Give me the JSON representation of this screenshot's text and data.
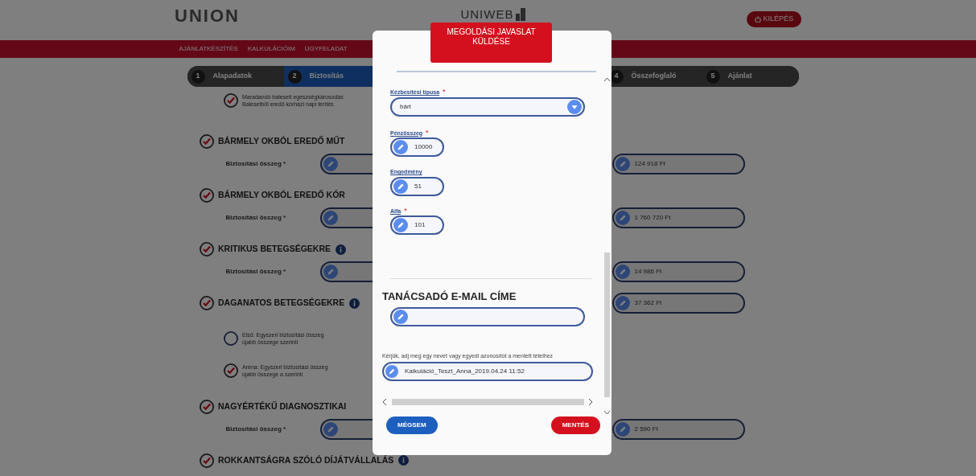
{
  "header": {
    "logo": "UNION",
    "center_logo": "UNIWEB",
    "logout_button": "KILÉPÉS"
  },
  "nav": [
    {
      "label": "AJÁNLATKÉSZÍTÉS"
    },
    {
      "label": "KALKULÁCIÓIM"
    },
    {
      "label": "ÜGYFELADAT"
    }
  ],
  "steps": [
    {
      "number": "1",
      "label": "Alapadatok",
      "selected": false
    },
    {
      "number": "2",
      "label": "Biztosítás",
      "selected": true
    },
    {
      "number": "4",
      "label": "Összefoglaló",
      "selected": false
    },
    {
      "number": "5",
      "label": "Ajánlat",
      "selected": false
    }
  ],
  "coverages": [
    {
      "kind": "option",
      "checked": true,
      "text": "Maradandó baleseti egészségkárosodás",
      "text_2": "Balesetből eredő kórházi napi térítés"
    },
    {
      "kind": "section",
      "checked": true,
      "title": "BÁRMELY OKBÓL EREDŐ MŰT",
      "field_label": "Biztosítási összeg *",
      "amount": "124 918 Ft"
    },
    {
      "kind": "section",
      "checked": true,
      "title": "BÁRMELY OKBÓL EREDŐ KÓR",
      "field_label": "Biztosítási összeg *",
      "amount": "1 760 720 Ft"
    },
    {
      "kind": "section",
      "checked": true,
      "title": "KRITIKUS BETEGSÉGEKRE",
      "info": true,
      "field_label": "Biztosítási összeg *",
      "amount": "14 986 Ft"
    },
    {
      "kind": "section",
      "checked": true,
      "title": "DAGANATOS BETEGSÉGEKRE",
      "info": true,
      "amount": "37 362 Ft"
    },
    {
      "kind": "option",
      "checked": false,
      "text": "Első: Egyszeri biztosítási összeg",
      "text_2": "újabb összege szerinti"
    },
    {
      "kind": "option",
      "checked": true,
      "text": "Aréna: Egyszeri biztosítási összeg",
      "text_2": "újabb összege a szerinti"
    },
    {
      "kind": "section",
      "checked": true,
      "title": "NAGYÉRTÉKŰ DIAGNOSZTIKAI",
      "field_label": "Biztosítási összeg *",
      "amount": "2 590 Ft"
    },
    {
      "kind": "section",
      "checked": true,
      "title": "ROKKANTSÁGRA SZÓLÓ DÍJÁTVÁLLALÁS",
      "info": true
    }
  ],
  "modal": {
    "title": "MEGOLDÁSI JAVASLAT KÜLDÉSE",
    "fields": [
      {
        "kind": "select",
        "label": "Kézbesítési típusa",
        "required_mark": "*",
        "value": "bárt"
      },
      {
        "kind": "text",
        "label": "Pénzösszeg",
        "required_mark": "*",
        "value": "10000"
      },
      {
        "kind": "text",
        "label": "Engedmény",
        "value": "51"
      },
      {
        "kind": "text",
        "label": "Alfa",
        "required_mark": "*",
        "value": "101"
      }
    ],
    "email_heading": "TANÁCSADÓ E-MAIL CÍME",
    "name_hint": "Kérjük, adj meg egy nevet vagy egyedi azonosítót a mentett tételhez",
    "name_value": "Kalkuláció_Teszt_Anna_2019.04.24 11:52",
    "buttons": [
      {
        "kind": "cancel",
        "label": "MÉGSEM"
      },
      {
        "kind": "save",
        "label": "MENTÉS"
      }
    ]
  }
}
